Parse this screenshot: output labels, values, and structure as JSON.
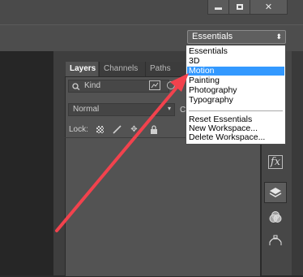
{
  "window": {
    "minimize_label": "▬",
    "maximize_label": "▢",
    "close_label": "✕"
  },
  "workspace_select": {
    "value": "Essentials",
    "arrow": "⬍"
  },
  "workspace_menu": {
    "items": [
      "Essentials",
      "3D",
      "Motion",
      "Painting",
      "Photography",
      "Typography"
    ],
    "highlighted": "Motion",
    "actions": [
      "Reset Essentials",
      "New Workspace...",
      "Delete Workspace..."
    ]
  },
  "panel": {
    "tabs": [
      "Layers",
      "Channels",
      "Paths"
    ],
    "kind_label": "Kind",
    "blend_mode": "Normal",
    "lock_label": "Lock:"
  },
  "dock_icons": [
    "fx-icon",
    "layers-icon",
    "adjustments-icon",
    "paths-icon"
  ],
  "colors": {
    "highlight": "#3399ff",
    "annotation_arrow": "#f2424d"
  }
}
